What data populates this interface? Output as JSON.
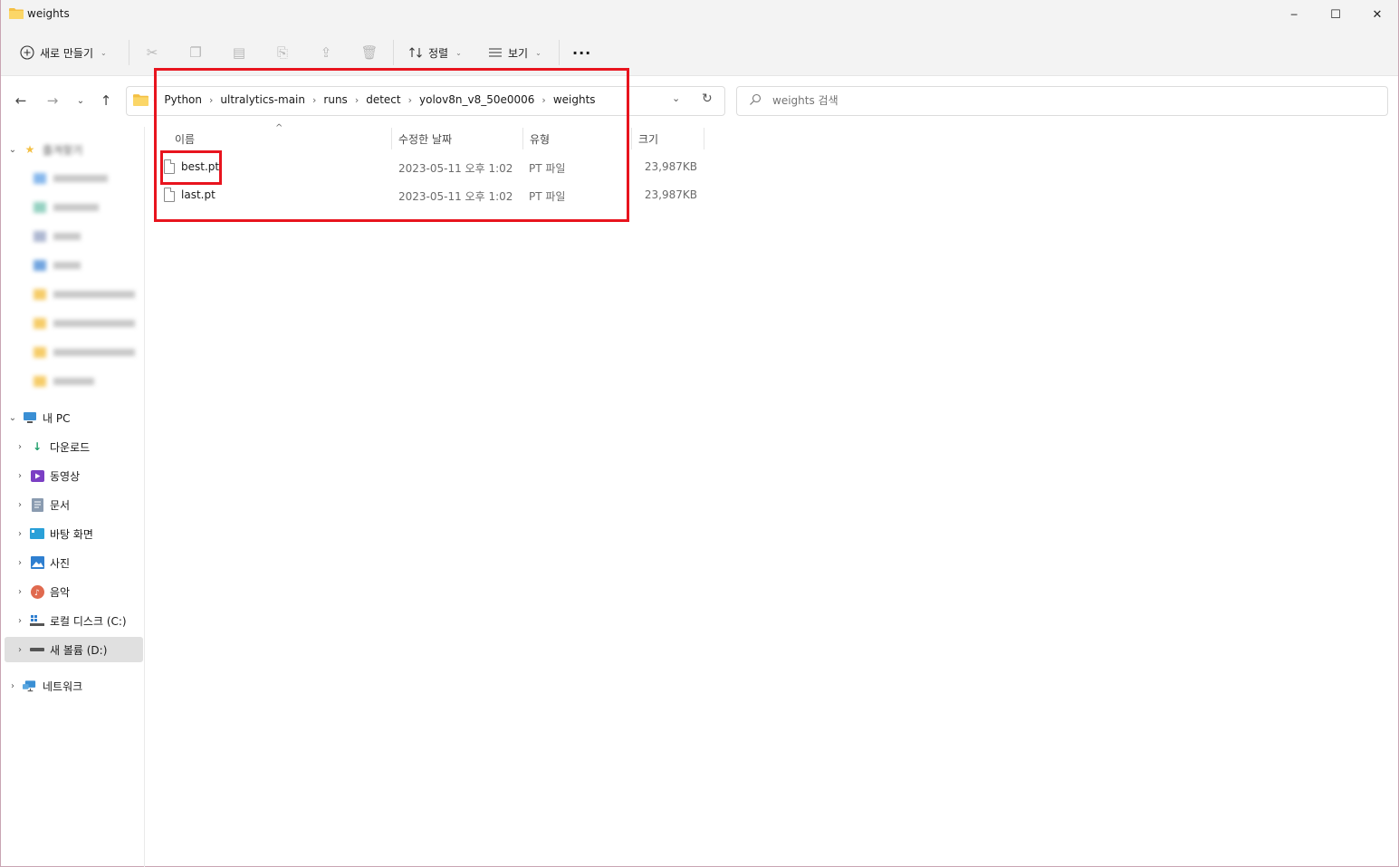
{
  "window": {
    "title": "weights",
    "minimize_glyph": "─",
    "maximize_glyph": "☐",
    "close_glyph": "✕"
  },
  "toolbar": {
    "new_label": "새로 만들기",
    "sort_label": "정렬",
    "view_label": "보기",
    "more_glyph": "···",
    "icons": [
      "cut-icon",
      "copy-icon",
      "paste-icon",
      "rename-icon",
      "share-icon",
      "delete-icon"
    ]
  },
  "address": {
    "crumbs": [
      "Python",
      "ultralytics-main",
      "runs",
      "detect",
      "yolov8n_v8_50e0006",
      "weights"
    ]
  },
  "search": {
    "placeholder": "weights 검색"
  },
  "columns": {
    "name": "이름",
    "modified": "수정한 날짜",
    "type": "유형",
    "size": "크기"
  },
  "files": [
    {
      "name": "best.pt",
      "modified": "2023-05-11 오후 1:02",
      "type": "PT 파일",
      "size": "23,987KB"
    },
    {
      "name": "last.pt",
      "modified": "2023-05-11 오후 1:02",
      "type": "PT 파일",
      "size": "23,987KB"
    }
  ],
  "sidebar": {
    "favorites_label": "즐겨찾기",
    "this_pc_label": "내 PC",
    "items": [
      {
        "label": "다운로드",
        "icon": "download-icon"
      },
      {
        "label": "동영상",
        "icon": "videos-icon"
      },
      {
        "label": "문서",
        "icon": "documents-icon"
      },
      {
        "label": "바탕 화면",
        "icon": "desktop-icon"
      },
      {
        "label": "사진",
        "icon": "pictures-icon"
      },
      {
        "label": "음악",
        "icon": "music-icon"
      },
      {
        "label": "로컬 디스크 (C:)",
        "icon": "drive-c-icon"
      },
      {
        "label": "새 볼륨 (D:)",
        "icon": "drive-d-icon"
      }
    ],
    "network_label": "네트워크"
  },
  "colors": {
    "annotation": "#e8141e",
    "folder": "#f4c044",
    "selected_nav": "#e0e0e0"
  }
}
